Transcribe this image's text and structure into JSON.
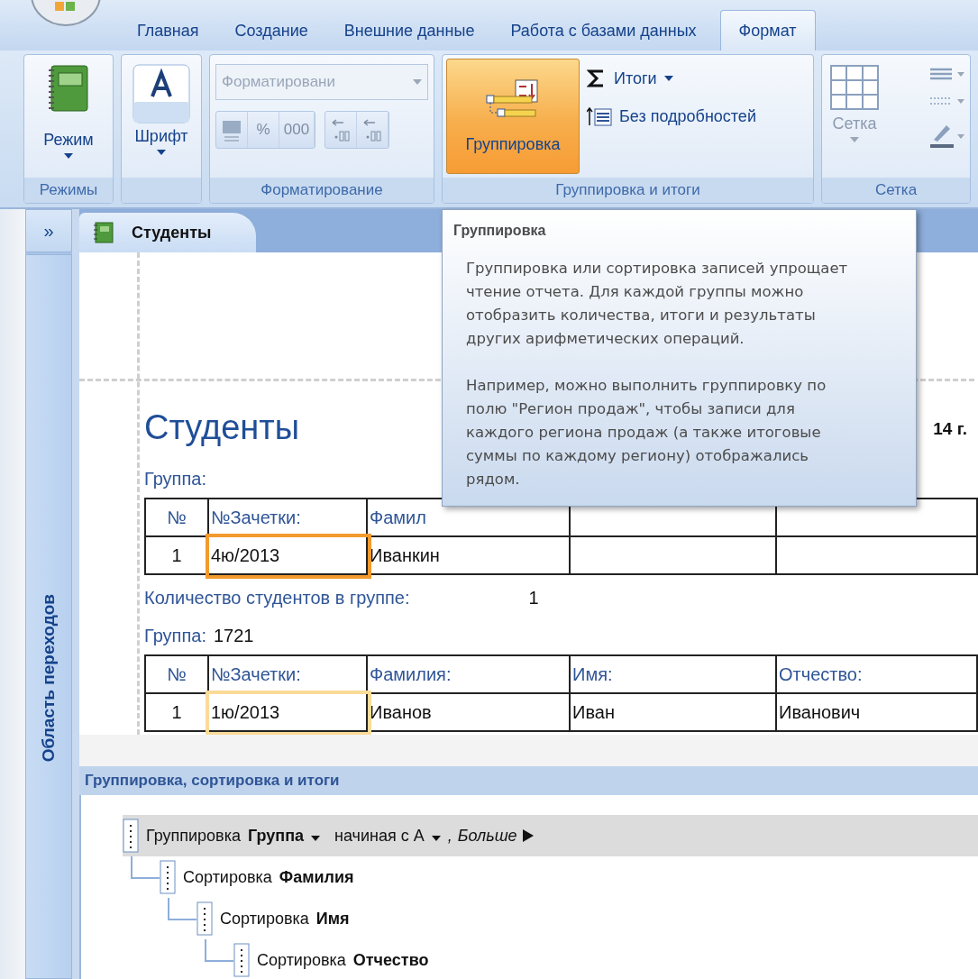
{
  "ribbon_tabs": [
    {
      "label": "Главная",
      "selected": false
    },
    {
      "label": "Создание",
      "selected": false
    },
    {
      "label": "Внешние данные",
      "selected": false
    },
    {
      "label": "Работа с базами данных",
      "selected": false
    },
    {
      "label": "Формат",
      "selected": true
    }
  ],
  "ribbon": {
    "modes": {
      "label": "Режимы",
      "button": "Режим"
    },
    "font": {
      "button": "Шрифт"
    },
    "formatting": {
      "label": "Форматирование",
      "dropdown": "Форматировани",
      "percent": "%",
      "thousands": "000",
      "disabled": true
    },
    "grouping": {
      "label": "Группировка и итоги",
      "group_button": "Группировка",
      "selected": true,
      "totals": "Итоги",
      "hide_details": "Без подробностей"
    },
    "grid": {
      "label": "Сетка",
      "button": "Сетка",
      "disabled": true
    }
  },
  "nav_pane": {
    "expand": "»",
    "title": "Область переходов"
  },
  "document_tab": {
    "label": "Студенты",
    "selected": true
  },
  "report": {
    "title": "Студенты",
    "date": "14 г.",
    "groups": [
      {
        "label": "Группа:",
        "columns": [
          "№",
          "№Зачетки:",
          "Фамил"
        ],
        "rows": [
          {
            "cells": [
              {
                "text": "1"
              },
              {
                "text": "4ю/2013",
                "selected": true,
                "focused": true
              },
              {
                "text": "Иванкин"
              }
            ]
          }
        ],
        "count_label": "Количество студентов в группе:",
        "count": "1"
      },
      {
        "label": "Группа:",
        "value": "1721",
        "columns": [
          "№",
          "№Зачетки:",
          "Фамилия:",
          "Имя:",
          "Отчество:"
        ],
        "rows": [
          {
            "cells": [
              {
                "text": "1"
              },
              {
                "text": "1ю/2013",
                "selected": true,
                "focused": false
              },
              {
                "text": "Иванов"
              },
              {
                "text": "Иван"
              },
              {
                "text": "Иванович"
              }
            ]
          }
        ]
      }
    ]
  },
  "tooltip": {
    "title": "Группировка",
    "paragraphs": [
      "Группировка или сортировка записей упрощает чтение отчета. Для каждой группы можно отобразить количества, итоги и результаты других арифметических операций.",
      "Например, можно выполнить группировку по полю \"Регион продаж\", чтобы записи для каждого региона продаж (а также итоговые суммы по каждому региону) отображались рядом."
    ]
  },
  "grouping_panel": {
    "title": "Группировка, сортировка и итоги",
    "levels": [
      {
        "kind": "group",
        "label": "Группировка",
        "field": "Группа",
        "order": "начиная с А",
        "separator": ",",
        "more": "Больше",
        "selected": true,
        "children": [
          {
            "kind": "sort",
            "label": "Сортировка",
            "field": "Фамилия",
            "selected": false,
            "children": [
              {
                "kind": "sort",
                "label": "Сортировка",
                "field": "Имя",
                "selected": false,
                "children": [
                  {
                    "kind": "sort",
                    "label": "Сортировка",
                    "field": "Отчество",
                    "selected": false
                  }
                ]
              }
            ]
          }
        ]
      }
    ]
  }
}
